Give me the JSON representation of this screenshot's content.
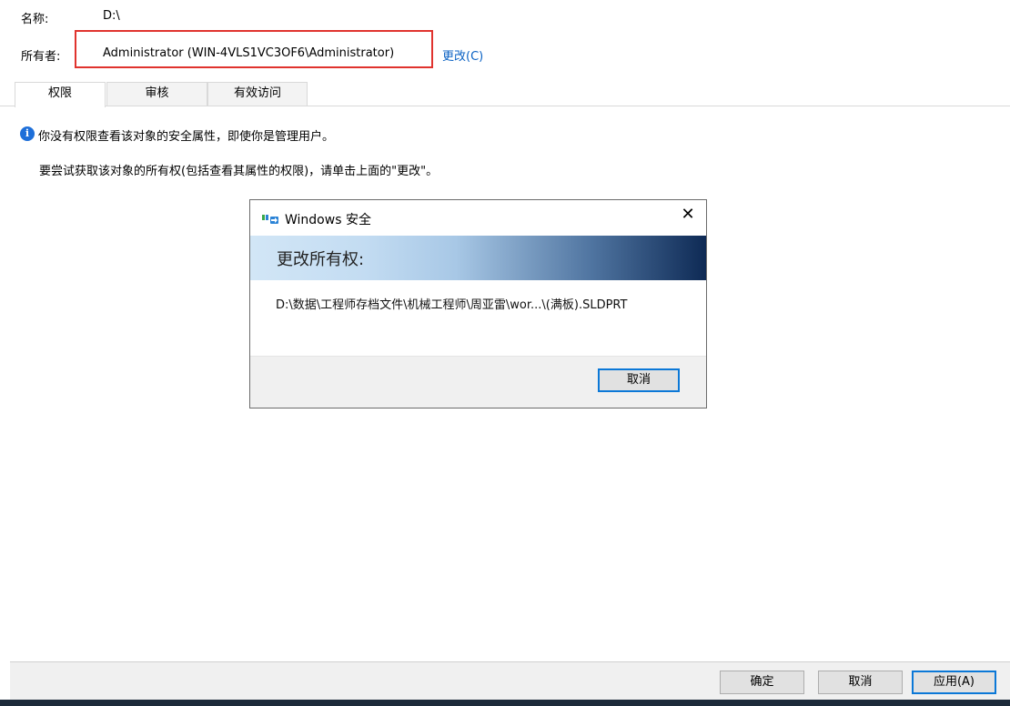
{
  "header": {
    "name_label": "名称:",
    "name_value": "D:\\",
    "owner_label": "所有者:",
    "owner_value": "Administrator (WIN-4VLS1VC3OF6\\Administrator)",
    "change_link": "更改(C)"
  },
  "tabs": [
    {
      "label": "权限",
      "active": true
    },
    {
      "label": "审核",
      "active": false
    },
    {
      "label": "有效访问",
      "active": false
    }
  ],
  "message": {
    "info_line": "你没有权限查看该对象的安全属性，即使你是管理用户。",
    "hint_line": "要尝试获取该对象的所有权(包括查看其属性的权限)，请单击上面的\"更改\"。"
  },
  "dialog": {
    "title": "Windows 安全",
    "close_glyph": "✕",
    "banner": "更改所有权:",
    "path": "D:\\数据\\工程师存档文件\\机械工程师\\周亚雷\\wor...\\(满板).SLDPRT",
    "cancel_label": "取消"
  },
  "footer": {
    "ok_label": "确定",
    "cancel_label": "取消",
    "apply_label": "应用(A)"
  },
  "icons": {
    "info": "info-icon",
    "shield": "windows-security-icon"
  },
  "colors": {
    "highlight_box": "#e0332e",
    "link": "#0b62c4",
    "info_icon": "#1e6fd9",
    "default_button_border": "#0b78d7"
  }
}
